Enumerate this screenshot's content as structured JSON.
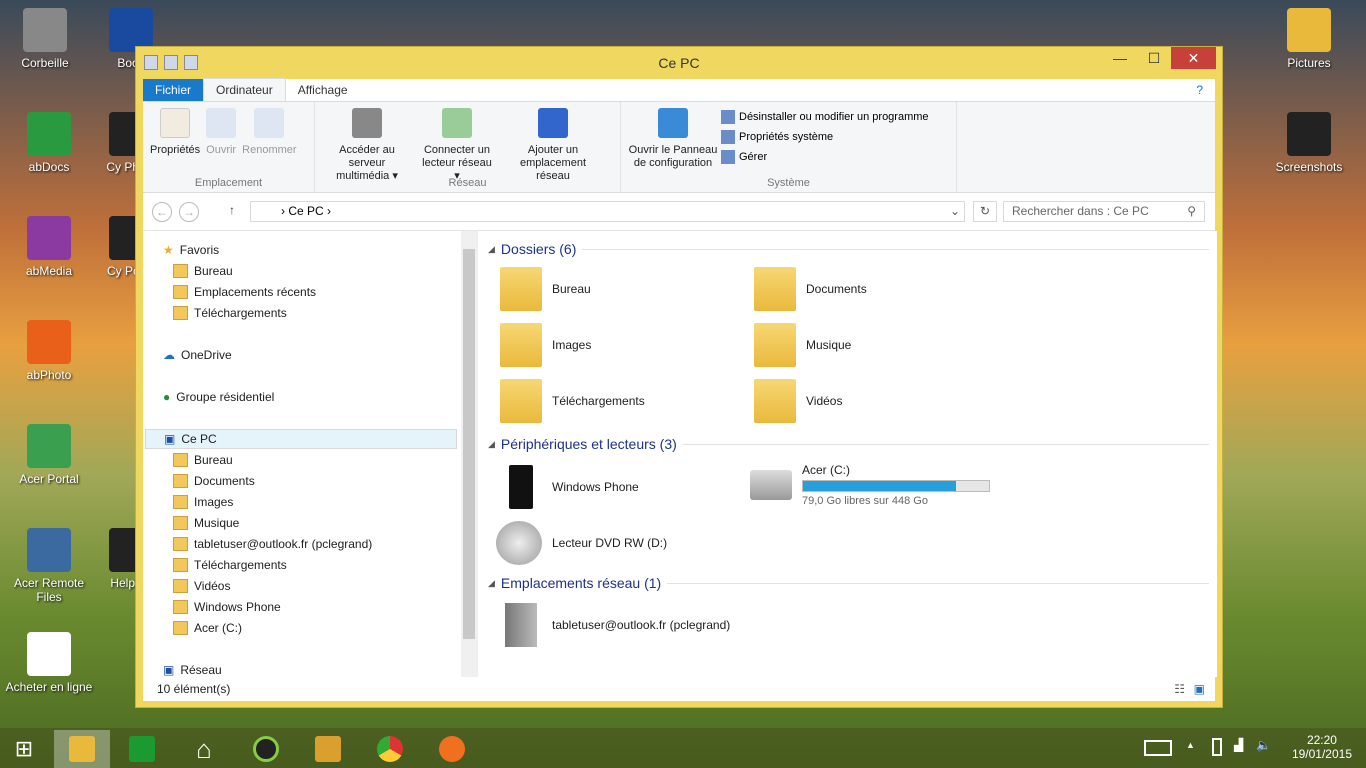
{
  "desktop": {
    "left": [
      "Corbeille",
      "Book",
      "abDocs",
      "Cy Photo",
      "abMedia",
      "Cy Powe",
      "abPhoto",
      "Acer Portal",
      "Acer Remote Files",
      "Help an",
      "Acheter en ligne"
    ],
    "right": [
      "Pictures",
      "Screenshots"
    ]
  },
  "window": {
    "title": "Ce PC",
    "controls": {
      "minimize": "—",
      "maximize": "☐",
      "close": "✕"
    }
  },
  "tabs": [
    "Fichier",
    "Ordinateur",
    "Affichage"
  ],
  "ribbon": {
    "emplacement": {
      "label": "Emplacement",
      "buttons": [
        "Propriétés",
        "Ouvrir",
        "Renommer"
      ]
    },
    "reseau": {
      "label": "Réseau",
      "buttons": [
        "Accéder au serveur multimédia ▾",
        "Connecter un lecteur réseau ▾",
        "Ajouter un emplacement réseau"
      ]
    },
    "systeme": {
      "label": "Système",
      "big": "Ouvrir le Panneau de configuration",
      "small": [
        "Désinstaller ou modifier un programme",
        "Propriétés système",
        "Gérer"
      ]
    }
  },
  "address": {
    "path": "Ce PC",
    "search_placeholder": "Rechercher dans : Ce PC"
  },
  "nav": {
    "favoris": "Favoris",
    "fav_items": [
      "Bureau",
      "Emplacements récents",
      "Téléchargements"
    ],
    "onedrive": "OneDrive",
    "groupe": "Groupe résidentiel",
    "cepc": "Ce PC",
    "pc_items": [
      "Bureau",
      "Documents",
      "Images",
      "Musique",
      "tabletuser@outlook.fr (pclegrand)",
      "Téléchargements",
      "Vidéos",
      "Windows Phone",
      "Acer (C:)"
    ],
    "reseau": "Réseau"
  },
  "content": {
    "folders_header": "Dossiers (6)",
    "folders": [
      "Bureau",
      "Documents",
      "Images",
      "Musique",
      "Téléchargements",
      "Vidéos"
    ],
    "devices_header": "Périphériques et lecteurs (3)",
    "phone": "Windows Phone",
    "drive_name": "Acer (C:)",
    "drive_free": "79,0 Go libres sur 448 Go",
    "drive_used_fraction": 0.824,
    "dvd": "Lecteur DVD RW (D:)",
    "network_header": "Emplacements réseau (1)",
    "network": "tabletuser@outlook.fr (pclegrand)"
  },
  "status": "10 élément(s)",
  "tray": {
    "time": "22:20",
    "date": "19/01/2015"
  },
  "colors": {
    "accent": "#1979ca",
    "titlebar": "#f0d860",
    "progress": "#26a0da"
  }
}
